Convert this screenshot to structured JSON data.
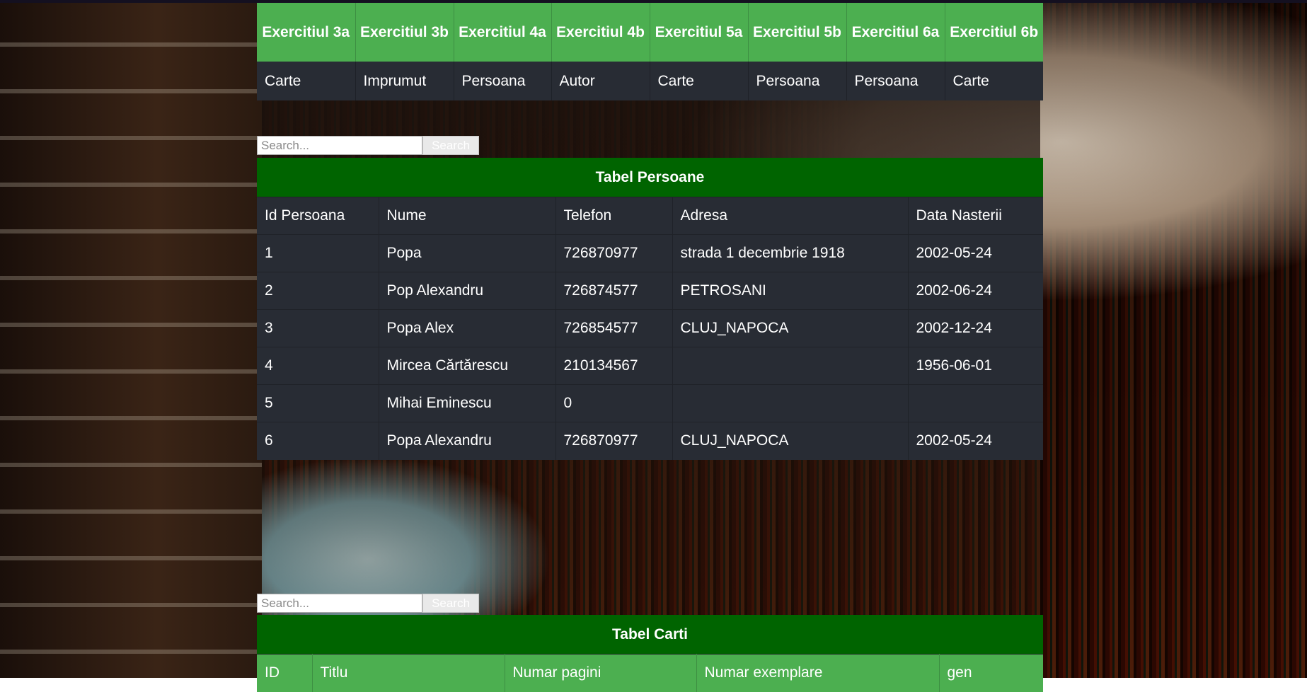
{
  "nav": {
    "headers": [
      "Exercitiul 3a",
      "Exercitiul 3b",
      "Exercitiul 4a",
      "Exercitiul 4b",
      "Exercitiul 5a",
      "Exercitiul 5b",
      "Exercitiul 6a",
      "Exercitiul 6b"
    ],
    "links": [
      "Carte",
      "Imprumut",
      "Persoana",
      "Autor",
      "Carte",
      "Persoana",
      "Persoana",
      "Carte"
    ]
  },
  "search1": {
    "placeholder": "Search...",
    "button": "Search"
  },
  "persoane": {
    "title": "Tabel Persoane",
    "columns": [
      "Id Persoana",
      "Nume",
      "Telefon",
      "Adresa",
      "Data Nasterii"
    ],
    "rows": [
      [
        "1",
        "Popa",
        "726870977",
        "strada 1 decembrie 1918",
        "2002-05-24"
      ],
      [
        "2",
        "Pop Alexandru",
        "726874577",
        "PETROSANI",
        "2002-06-24"
      ],
      [
        "3",
        "Popa Alex",
        "726854577",
        "CLUJ_NAPOCA",
        "2002-12-24"
      ],
      [
        "4",
        "Mircea Cărtărescu",
        "210134567",
        "",
        "1956-06-01"
      ],
      [
        "5",
        "Mihai Eminescu",
        "0",
        "",
        ""
      ],
      [
        "6",
        "Popa Alexandru",
        "726870977",
        "CLUJ_NAPOCA",
        "2002-05-24"
      ]
    ]
  },
  "search2": {
    "placeholder": "Search...",
    "button": "Search"
  },
  "carti": {
    "title": "Tabel Carti",
    "columns": [
      "ID",
      "Titlu",
      "Numar pagini",
      "Numar exemplare",
      "gen"
    ]
  }
}
